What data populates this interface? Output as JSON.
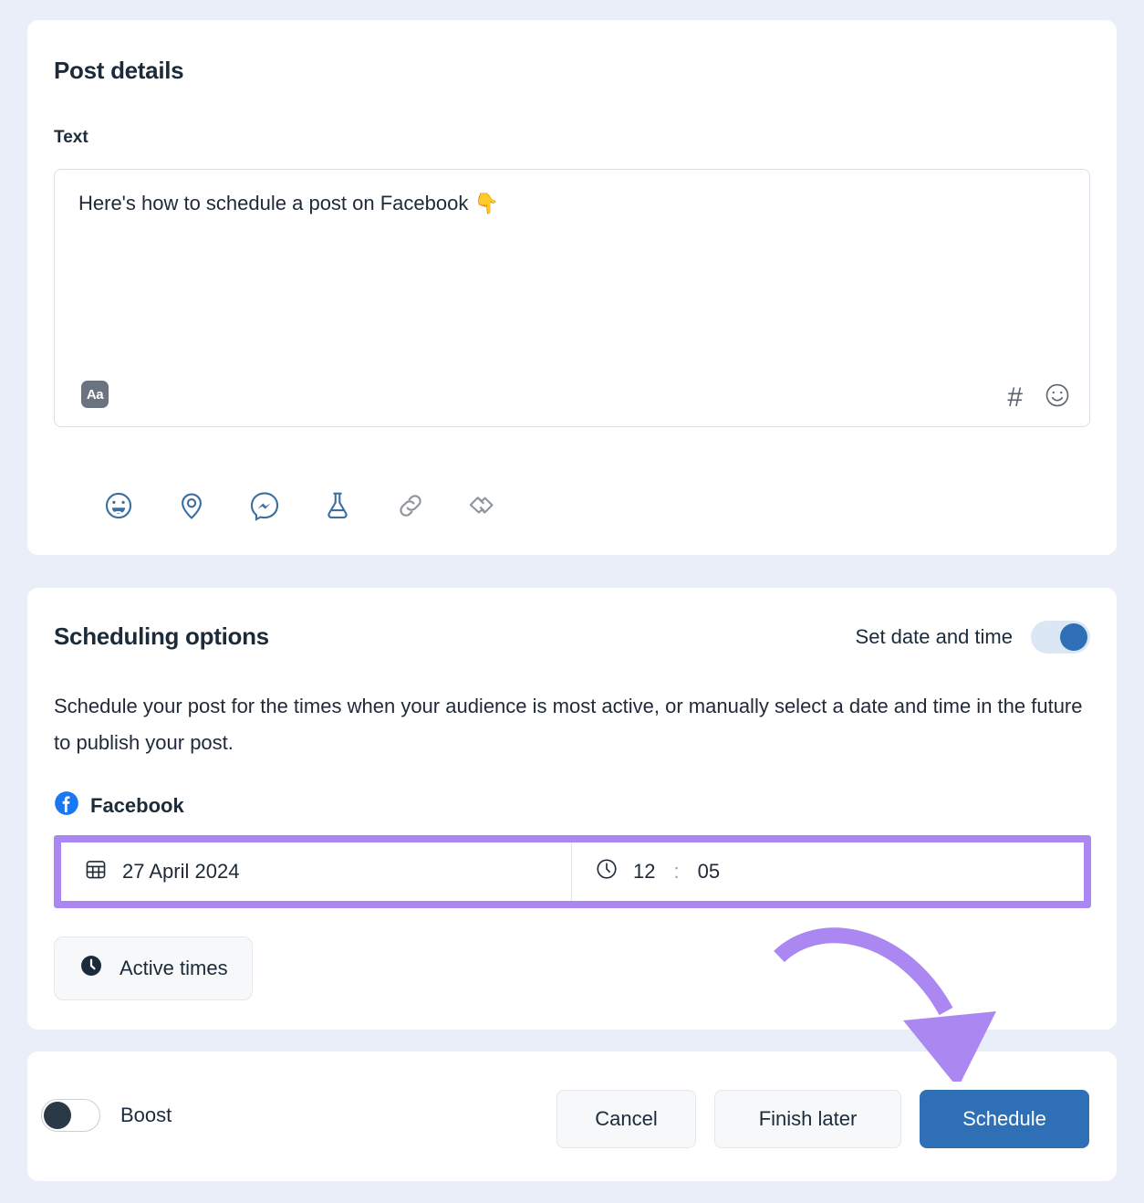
{
  "theme": {
    "background": "#e9eef8",
    "card_background": "#ffffff",
    "accent_blue": "#2f6fb5",
    "annotation_purple": "#ab87f1",
    "text_dark": "#1c2b3a",
    "icon_blue": "#3b6fa0",
    "icon_gray": "#8c949e"
  },
  "post_details": {
    "title": "Post details",
    "text_label": "Text",
    "post_text": "Here's how to schedule a post on Facebook 👇",
    "editor": {
      "format_button_label": "Aa",
      "hashtag_icon_glyph": "#",
      "emoji_icon_glyph": "☺"
    },
    "attachments": [
      {
        "name": "feeling-activity-icon",
        "label": "Feeling/Activity"
      },
      {
        "name": "location-icon",
        "label": "Check in"
      },
      {
        "name": "messenger-icon",
        "label": "Messenger"
      },
      {
        "name": "experiment-icon",
        "label": "Post testing"
      },
      {
        "name": "link-icon",
        "label": "Link"
      },
      {
        "name": "collaboration-icon",
        "label": "Collaboration"
      }
    ]
  },
  "scheduling": {
    "title": "Scheduling options",
    "set_date_time_label": "Set date and time",
    "set_date_time_on": true,
    "description": "Schedule your post for the times when your audience is most active, or manually select a date and time in the future to publish your post.",
    "network": {
      "name": "Facebook",
      "icon": "facebook-icon"
    },
    "date_value": "27 April 2024",
    "time_hours": "12",
    "time_separator": ":",
    "time_minutes": "05",
    "active_times_label": "Active times"
  },
  "footer": {
    "boost_label": "Boost",
    "boost_on": false,
    "cancel_label": "Cancel",
    "finish_later_label": "Finish later",
    "schedule_label": "Schedule"
  },
  "annotation": {
    "arrow_target": "schedule-button",
    "highlight_target": "datetime-fields"
  }
}
